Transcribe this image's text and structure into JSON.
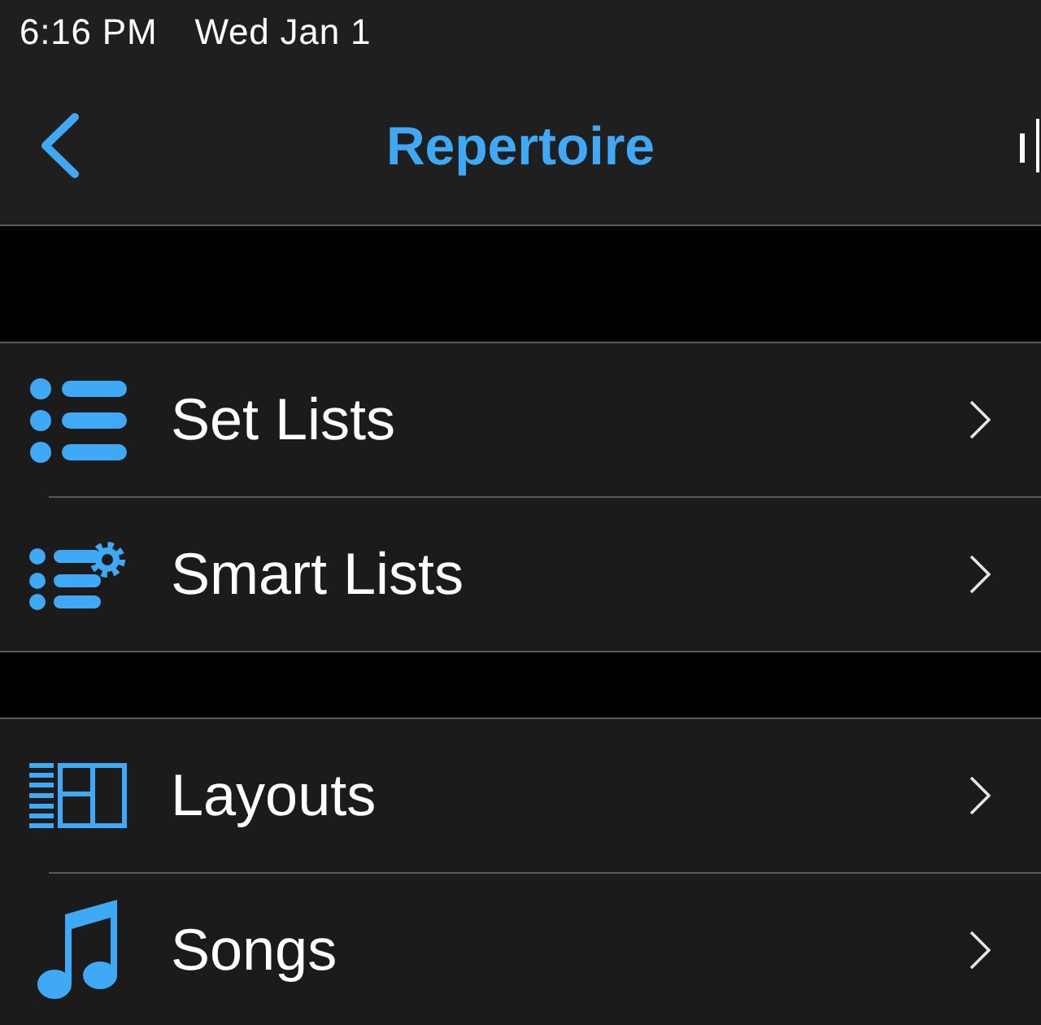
{
  "status_bar": {
    "time": "6:16 PM",
    "date": "Wed Jan 1"
  },
  "nav_bar": {
    "title": "Repertoire"
  },
  "sections": [
    {
      "items": [
        {
          "label": "Set Lists"
        },
        {
          "label": "Smart Lists"
        }
      ]
    },
    {
      "items": [
        {
          "label": "Layouts"
        },
        {
          "label": "Songs"
        }
      ]
    }
  ]
}
